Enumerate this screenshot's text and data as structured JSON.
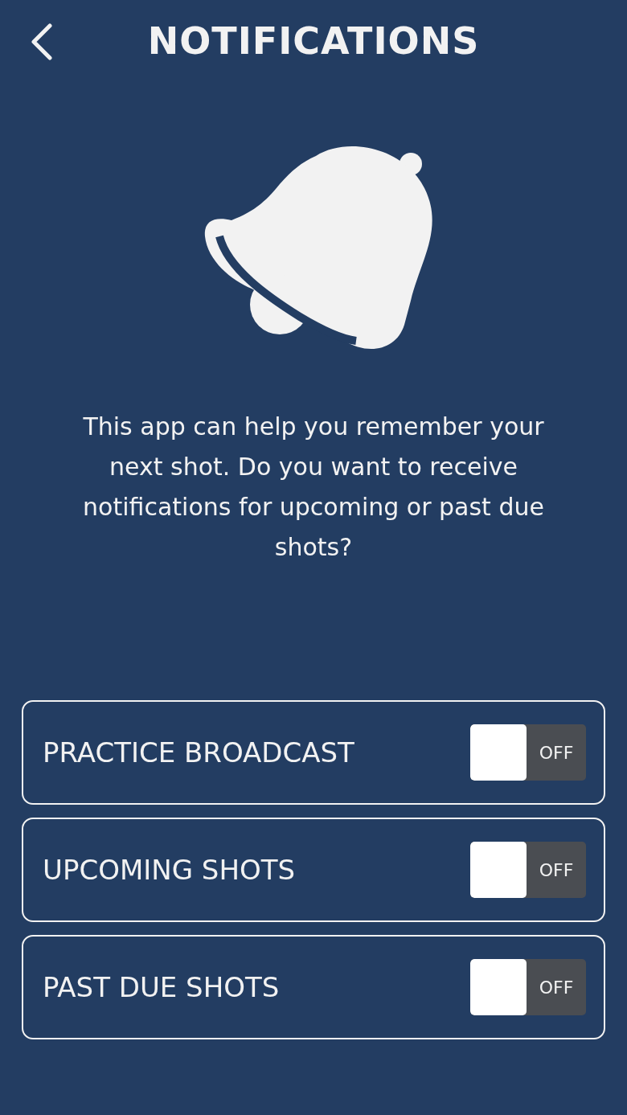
{
  "header": {
    "title": "NOTIFICATIONS"
  },
  "message": "This app can help you remember your next shot. Do you want to receive notifications for upcoming or past due shots?",
  "settings": [
    {
      "label": "PRACTICE BROADCAST",
      "on": false,
      "state_text": "OFF"
    },
    {
      "label": "UPCOMING SHOTS",
      "on": false,
      "state_text": "OFF"
    },
    {
      "label": "PAST DUE SHOTS",
      "on": false,
      "state_text": "OFF"
    }
  ]
}
